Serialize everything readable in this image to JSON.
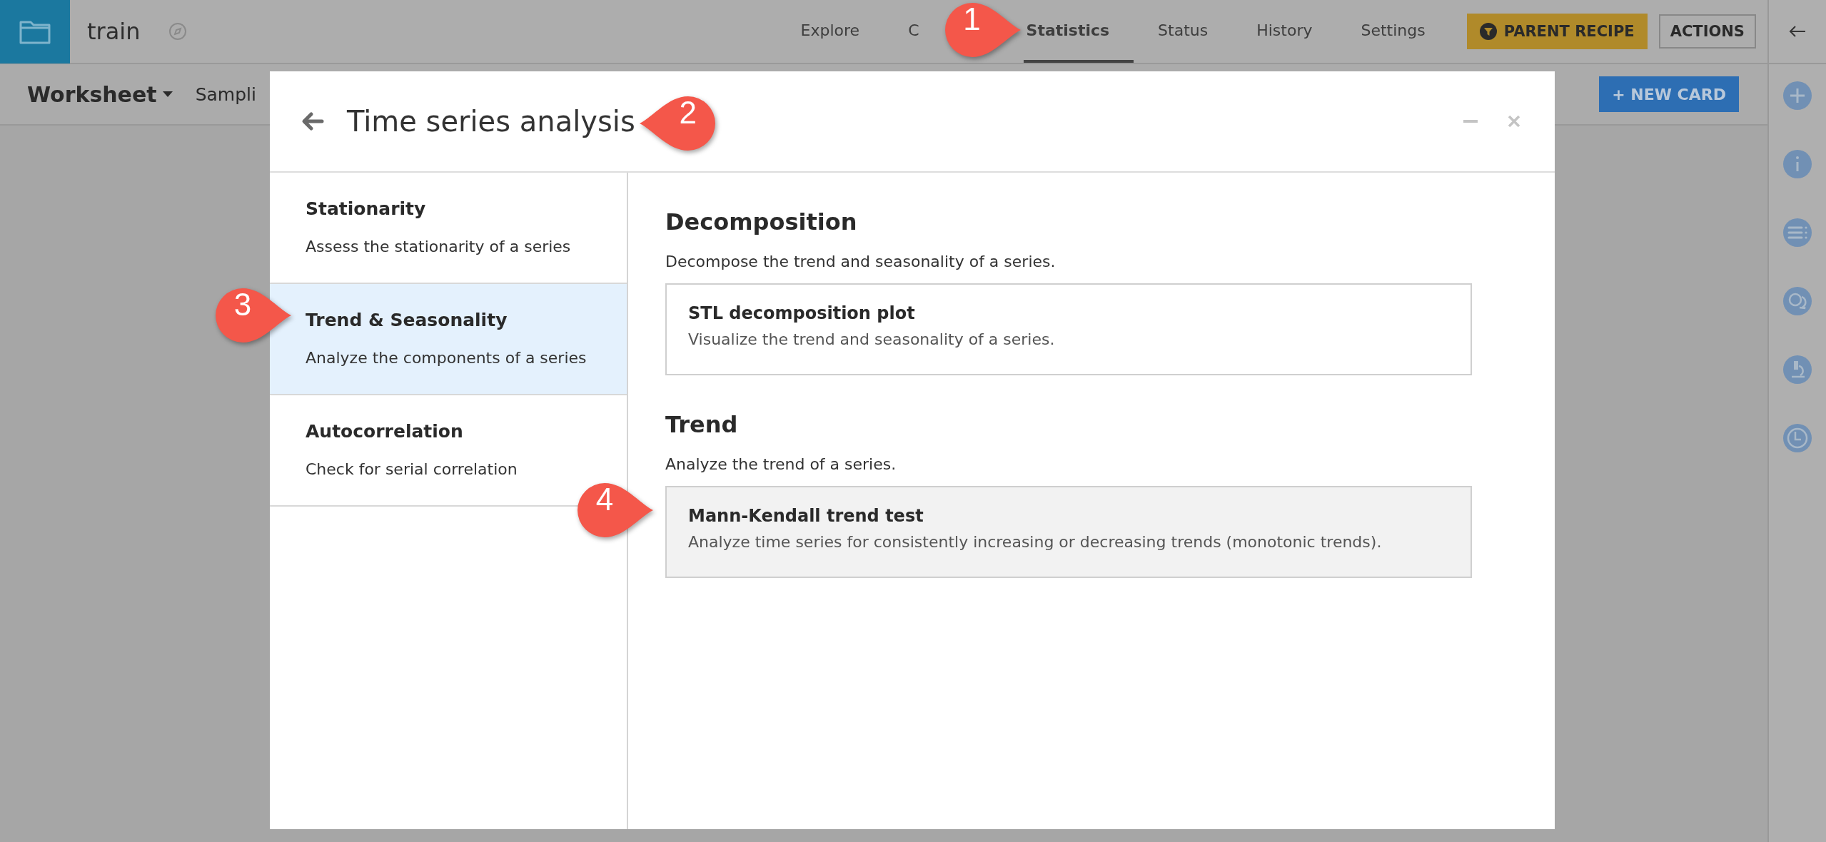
{
  "app_bar": {
    "title": "train",
    "tabs": [
      {
        "label": "Explore",
        "selected": false
      },
      {
        "label": "C",
        "selected": false
      },
      {
        "label": "Statistics",
        "selected": true,
        "callout": "1"
      },
      {
        "label": "Status",
        "selected": false
      },
      {
        "label": "History",
        "selected": false
      },
      {
        "label": "Settings",
        "selected": false
      }
    ],
    "parent_recipe_button": "PARENT RECIPE",
    "actions_button": "ACTIONS"
  },
  "sub_bar": {
    "worksheet": "Worksheet",
    "sampling": "Sampli",
    "new_card_button": "+ NEW CARD"
  },
  "modal": {
    "title": "Time series analysis",
    "callout": "2",
    "categories": [
      {
        "title": "Stationarity",
        "description": "Assess the stationarity of a series",
        "selected": false
      },
      {
        "title": "Trend & Seasonality",
        "description": "Analyze the components of a series",
        "selected": true,
        "callout": "3"
      },
      {
        "title": "Autocorrelation",
        "description": "Check for serial correlation",
        "selected": false
      }
    ],
    "sections": [
      {
        "heading": "Decomposition",
        "description": "Decompose the trend and seasonality of a series.",
        "cards": [
          {
            "title": "STL decomposition plot",
            "description": "Visualize the trend and seasonality of a series.",
            "highlighted": false
          }
        ]
      },
      {
        "heading": "Trend",
        "description": "Analyze the trend of a series.",
        "cards": [
          {
            "title": "Mann-Kendall trend test",
            "description": "Analyze time series for consistently increasing or decreasing trends (monotonic trends).",
            "highlighted": true,
            "callout": "4"
          }
        ]
      }
    ]
  }
}
